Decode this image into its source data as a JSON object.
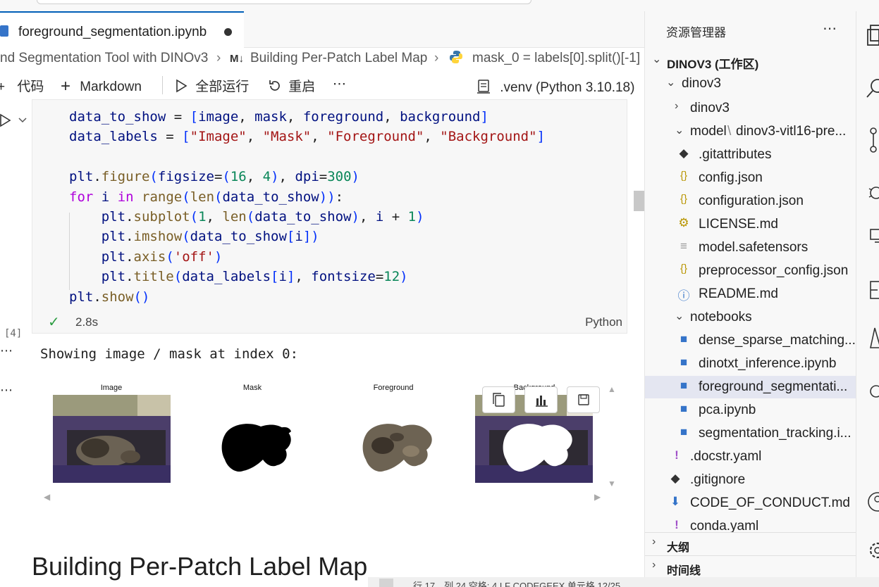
{
  "tab": {
    "title": "foreground_segmentation.ipynb"
  },
  "breadcrumb": {
    "part1": "nd Segmentation Tool with DINOv3",
    "part2": "Building Per-Patch Label Map",
    "part3": "mask_0 = labels[0].split()[-1]",
    "md_badge": "M↓"
  },
  "toolbar": {
    "add_code": "代码",
    "add_markdown": "Markdown",
    "run_all": "全部运行",
    "restart": "重启",
    "more": "⋯",
    "kernel": ".venv (Python 3.10.18)"
  },
  "cell": {
    "exec_count": "[4]",
    "duration": "2.8s",
    "language": "Python"
  },
  "output": {
    "text": "Showing image / mask at index 0:",
    "titles": [
      "Image",
      "Mask",
      "Foreground",
      "Background"
    ]
  },
  "markdown_heading": "Building Per-Patch Label Map",
  "explorer": {
    "title": "资源管理器",
    "more": "⋯",
    "workspace": "DINOV3 (工作区)",
    "items": [
      {
        "label": "dinov3"
      },
      {
        "label": "dinov3"
      },
      {
        "label": "model",
        "sublabel": "dinov3-vitl16-pre..."
      },
      {
        "label": ".gitattributes"
      },
      {
        "label": "config.json"
      },
      {
        "label": "configuration.json"
      },
      {
        "label": "LICENSE.md"
      },
      {
        "label": "model.safetensors"
      },
      {
        "label": "preprocessor_config.json"
      },
      {
        "label": "README.md"
      },
      {
        "label": "notebooks"
      },
      {
        "label": "dense_sparse_matching...."
      },
      {
        "label": "dinotxt_inference.ipynb"
      },
      {
        "label": "foreground_segmentati..."
      },
      {
        "label": "pca.ipynb"
      },
      {
        "label": "segmentation_tracking.i..."
      },
      {
        "label": ".docstr.yaml"
      },
      {
        "label": ".gitignore"
      },
      {
        "label": "CODE_OF_CONDUCT.md"
      },
      {
        "label": "conda.yaml"
      }
    ],
    "outline": "大纲",
    "timeline": "时间线"
  },
  "statusbar": {
    "text": "行 17，列 24    空格: 4    LF    CODEGEEX    单元格 12/25"
  },
  "colors": {
    "accent": "#005fb8",
    "keyword": "#af00db",
    "function": "#795e26",
    "variable": "#001080",
    "string": "#a31515",
    "number": "#098658",
    "success": "#2e9e44"
  }
}
